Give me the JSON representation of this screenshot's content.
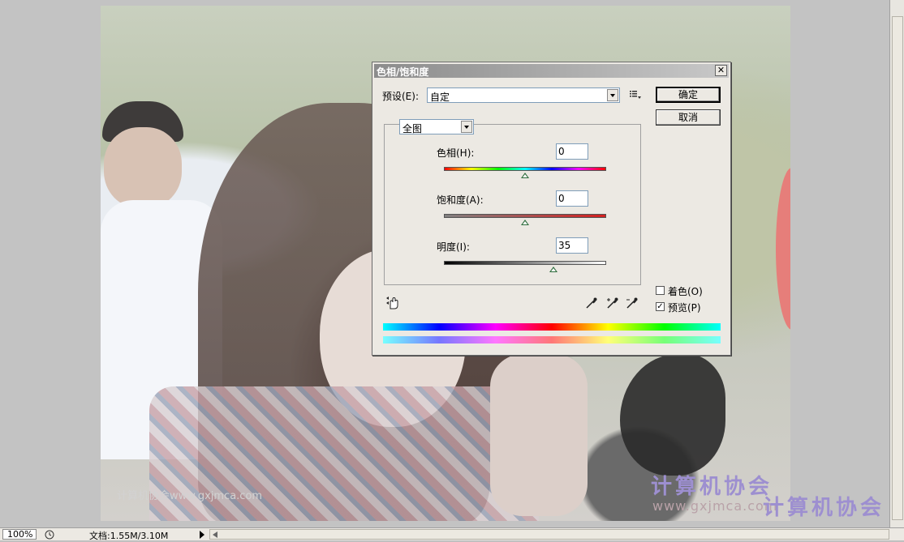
{
  "dialog": {
    "title": "色相/饱和度",
    "close_label": "✕",
    "preset_label": "预设(E):",
    "preset_value": "自定",
    "ok_label": "确定",
    "cancel_label": "取消",
    "edit_value": "全图",
    "hue_label": "色相(H):",
    "hue_value": "0",
    "saturation_label": "饱和度(A):",
    "saturation_value": "0",
    "lightness_label": "明度(I):",
    "lightness_value": "35",
    "colorize_label": "着色(O)",
    "colorize_checked": false,
    "preview_label": "预览(P)",
    "preview_checked": true,
    "preview_check_glyph": "✓"
  },
  "sliders": {
    "hue_fraction": 0.5,
    "saturation_fraction": 0.5,
    "lightness_fraction": 0.675
  },
  "canvas": {
    "watermark_small": "计算机协会www.gxjmca.com",
    "watermark_big_1": "计算机协会",
    "watermark_url": "www.gxjmca.com",
    "watermark_big_2": "计算机协会"
  },
  "statusbar": {
    "zoom": "100%",
    "doc_info": "文档:1.55M/3.10M"
  },
  "icons": [
    "close-icon",
    "dropdown-arrow-icon",
    "preset-menu-icon",
    "hand-adjust-icon",
    "eyedropper-icon",
    "eyedropper-plus-icon",
    "eyedropper-minus-icon",
    "status-menu-arrow-icon",
    "scroll-left-icon"
  ]
}
